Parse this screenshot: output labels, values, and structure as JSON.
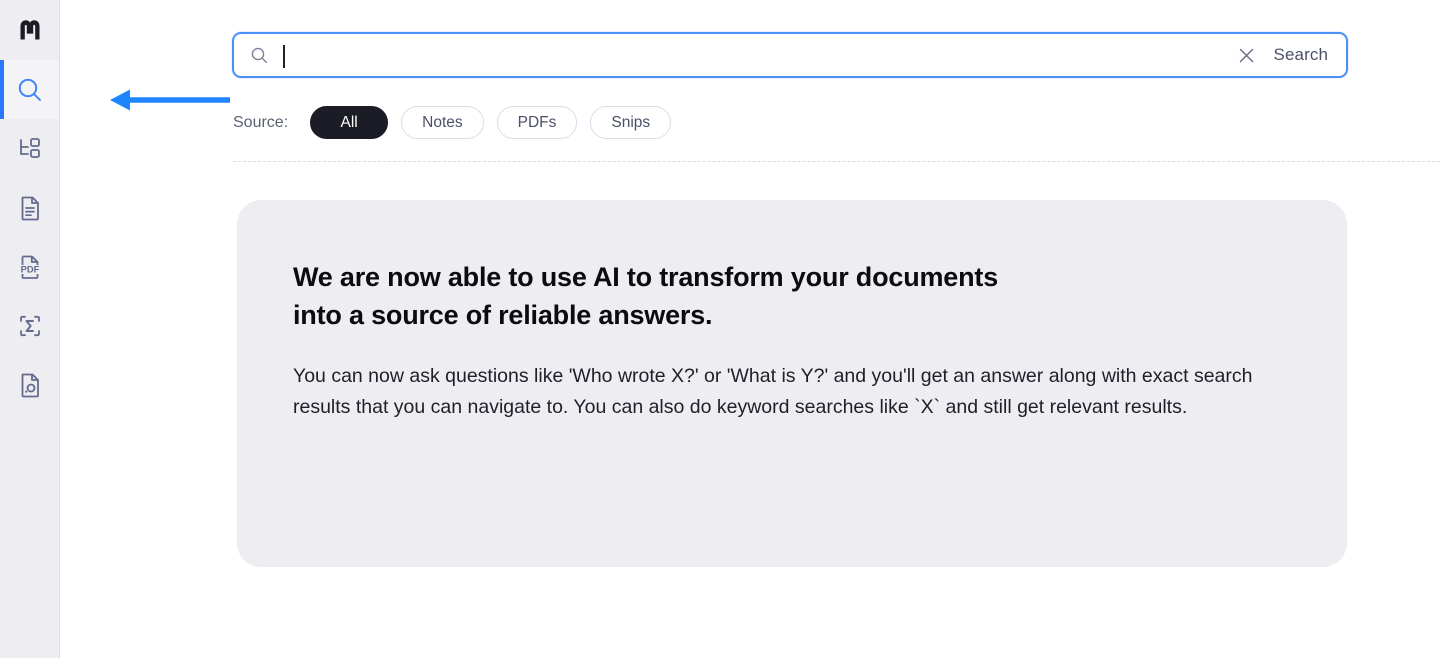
{
  "app": {
    "logo_name": "mem-logo"
  },
  "sidebar": {
    "items": [
      {
        "icon": "search-icon",
        "name": "search",
        "active": true
      },
      {
        "icon": "hierarchy-tree-icon",
        "name": "graph",
        "active": false
      },
      {
        "icon": "document-text-icon",
        "name": "notes",
        "active": false
      },
      {
        "icon": "pdf-file-icon",
        "name": "pdfs",
        "active": false
      },
      {
        "icon": "sigma-scan-icon",
        "name": "formulas",
        "active": false
      },
      {
        "icon": "snip-document-icon",
        "name": "snips",
        "active": false
      }
    ]
  },
  "search": {
    "value": "",
    "placeholder": "",
    "lens_icon": "search-icon",
    "clear_icon": "close-icon",
    "action_label": "Search"
  },
  "filters": {
    "label": "Source:",
    "options": [
      {
        "label": "All",
        "selected": true
      },
      {
        "label": "Notes",
        "selected": false
      },
      {
        "label": "PDFs",
        "selected": false
      },
      {
        "label": "Snips",
        "selected": false
      }
    ]
  },
  "announcement": {
    "heading": "We are now able to use AI to transform your documents into a source of reliable answers.",
    "body": "You can now ask questions like 'Who wrote X?' or 'What is Y?' and you'll get an answer along with exact search results that you can navigate to. You can also do keyword searches like `X` and still get relevant results."
  },
  "annotation": {
    "arrow_icon": "left-arrow-annotation",
    "color": "#1f85ff"
  },
  "colors": {
    "accent": "#2979ff",
    "sidebar_bg": "#eeedf2",
    "card_bg": "#eeedf2",
    "pill_selected_bg": "#1b1c26",
    "text_primary": "#1e2029",
    "text_muted": "#4b5068"
  }
}
